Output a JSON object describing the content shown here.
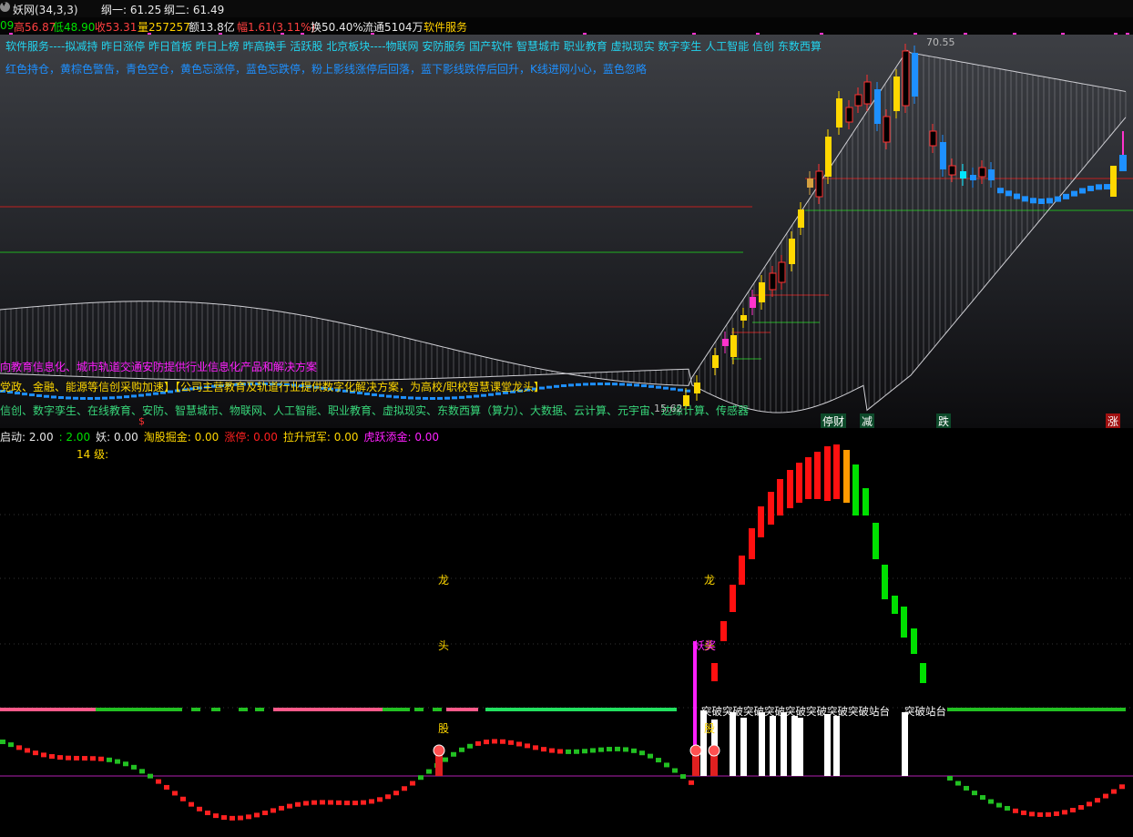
{
  "title_bar": {
    "indicator_name": "妖网(34,3,3)",
    "line1": "纲一: 61.25",
    "line2": "纲二: 61.49"
  },
  "quote_bar": {
    "open_tail": "09",
    "high": "高56.87",
    "low": "低48.90",
    "close": "收53.31",
    "volume": "量257257",
    "amount": "额13.8亿",
    "change": "幅1.61(3.11%)",
    "turnover": "换50.40%",
    "float": "流通5104万",
    "sector": "软件服务"
  },
  "upper": {
    "concept_line": "软件服务----拟减持 昨日涨停 昨日首板 昨日上榜 昨高换手 活跃股 北京板块----物联网 安防服务 国产软件 智慧城市 职业教育 虚拟现实 数字孪生 人工智能 信创 东数西算",
    "legend_line": "红色持仓，黄棕色警告，青色空仓，黄色忘涨停，蓝色忘跌停，粉上影线涨停后回落，蓝下影线跌停后回升，K线进网小心，蓝色忽略",
    "peak_price": "70.55",
    "magenta_scroll": "向教育信息化、城市轨道交通安防提供行业信息化产品和解决方案",
    "yellow_scroll": "党政、金融、能源等信创采购加速】【公司主营教育及轨道行业提供数字化解决方案，为高校/职校智慧课堂龙头】",
    "green_scroll": "信创、数字孪生、在线教育、安防、智慧城市、物联网、人工智能、职业教育、虚拟现实、东数西算（算力）、大数据、云计算、元宇宙、边缘计算、传感器",
    "low_price": "15.62",
    "dollar_mark": "$",
    "tags": {
      "t1": "停财",
      "t2": "减",
      "t3": "跌",
      "t4": "涨"
    }
  },
  "lower": {
    "values": {
      "start": "启动: 2.00",
      "two": ": 2.00",
      "yao": "妖: 0.00",
      "taogu": "淘股掘金: 0.00",
      "zhangting": "涨停: 0.00",
      "lashen": "拉升冠军: 0.00",
      "huyue": "虎跃添金: 0.00"
    },
    "level": "14  级:",
    "long1": "龙",
    "tou1": "头",
    "gu1": "股",
    "long2": "龙",
    "tou2": "头",
    "gu2": "股",
    "pulsestar": "妖奖",
    "breakout_multi": "突破突破突破突破突破突破突破突破站台",
    "breakout_single": "突破站台"
  },
  "colors": {
    "up": "#ff2020",
    "down": "#00e5ff",
    "yellow_candle": "#ffd700",
    "blue_candle": "#1e90ff",
    "green_bar": "#00e000",
    "red_bar": "#ff1010",
    "magenta": "#ff20ff",
    "concept_cyan": "#22d3ee"
  }
}
